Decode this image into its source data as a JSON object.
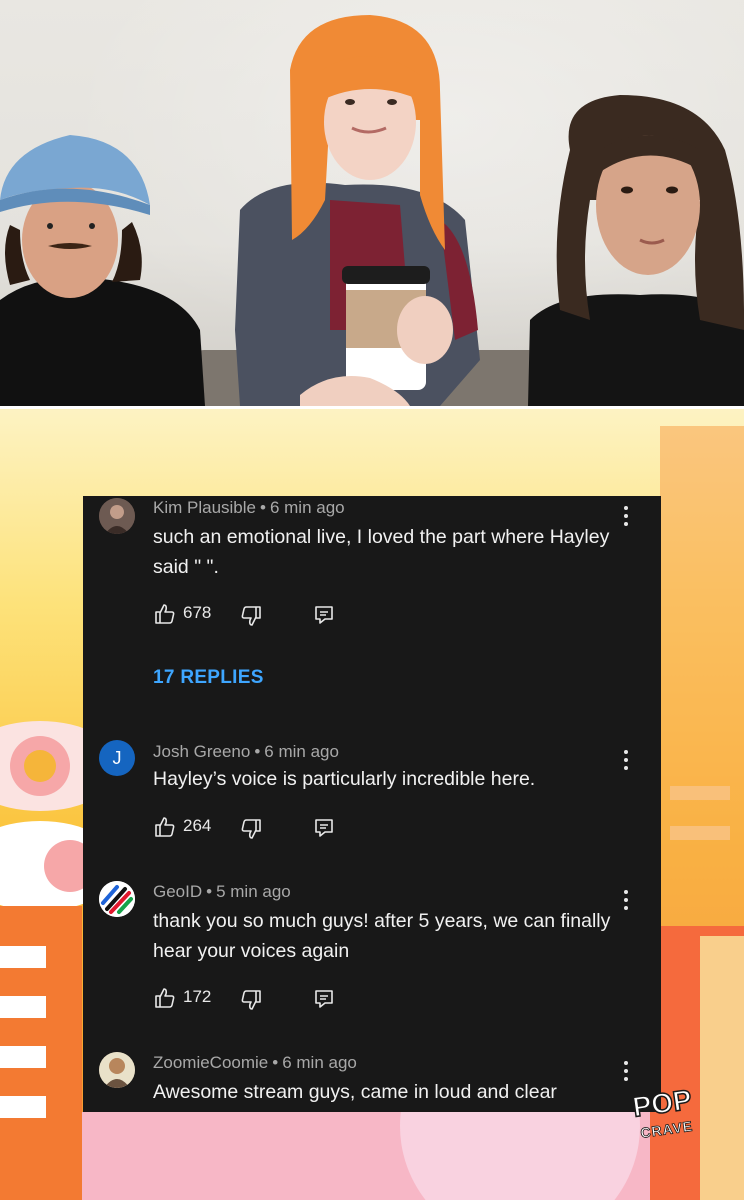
{
  "logo": {
    "line1": "POP",
    "line2": "CRAVE"
  },
  "comments": [
    {
      "author": "Kim Plausible",
      "time": "6 min ago",
      "text": "such an emotional live, I loved the part where Hayley said \"    \".",
      "likes": "678",
      "avatar_icon": "profile-photo-icon",
      "replies_label": "17 REPLIES"
    },
    {
      "author": "Josh Greeno",
      "time": "6 min ago",
      "text": "Hayley’s voice is particularly incredible here.",
      "likes": "264",
      "avatar_letter": "J",
      "avatar_color": "#1565c0"
    },
    {
      "author": "GeoID",
      "time": "5 min ago",
      "text": "thank you so much guys! after 5 years, we can finally hear your voices again",
      "likes": "172",
      "avatar_icon": "striped-logo-icon"
    },
    {
      "author": "ZoomieCoomie",
      "time": "6 min ago",
      "text": "Awesome stream guys, came in loud and clear",
      "avatar_icon": "profile-photo-icon"
    }
  ],
  "colors": {
    "panel_bg": "#181818",
    "replies_link": "#3ea6ff",
    "meta_text": "#a8a8a8"
  }
}
